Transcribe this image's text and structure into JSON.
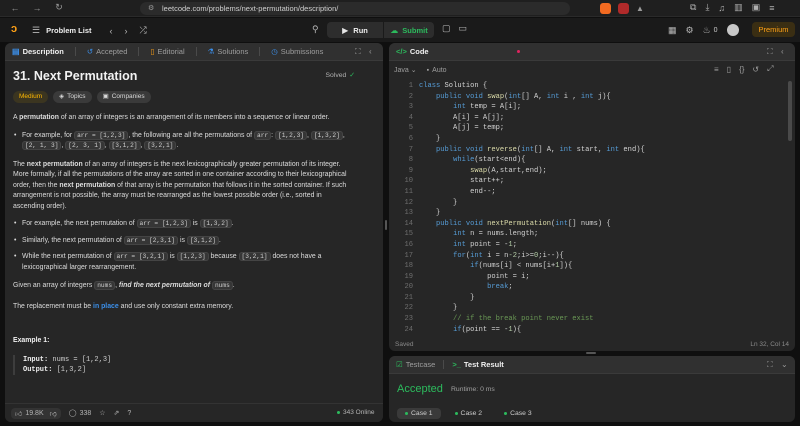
{
  "browser": {
    "url": "leetcode.com/problems/next-permutation/description/",
    "notification_count": "3"
  },
  "header": {
    "problem_list_label": "Problem List",
    "run_label": "Run",
    "submit_label": "Submit",
    "streak_count": "0",
    "premium_label": "Premium"
  },
  "left_tabs": [
    {
      "label": "Description",
      "icon": "description-icon"
    },
    {
      "label": "Accepted",
      "icon": "history-icon"
    },
    {
      "label": "Editorial",
      "icon": "book-icon"
    },
    {
      "label": "Solutions",
      "icon": "flask-icon"
    },
    {
      "label": "Submissions",
      "icon": "clock-icon"
    }
  ],
  "problem": {
    "title": "31. Next Permutation",
    "solved_label": "Solved",
    "difficulty": "Medium",
    "topics_label": "Topics",
    "companies_label": "Companies",
    "intro_bold": "permutation",
    "intro_pre": "A ",
    "intro_post": " of an array of integers is an arrangement of its members into a sequence or linear order.",
    "bullet1_pre": "For example, for ",
    "bullet1_code": "arr = [1,2,3]",
    "bullet1_post": ", the following are all the permutations of ",
    "bullet1_code2": "arr",
    "bullet1_codes": [
      "[1,2,3]",
      "[1,3,2]",
      "[2, 1, 3]",
      "[2, 3, 1]",
      "[3,1,2]",
      "[3,2,1]"
    ],
    "para2_pre": "The ",
    "para2_bold": "next permutation",
    "para2_mid": " of an array of integers is the next lexicographically greater permutation of its integer. More formally, if all the permutations of the array are sorted in one container according to their lexicographical order, then the ",
    "para2_bold2": "next permutation",
    "para2_post": " of that array is the permutation that follows it in the sorted container. If such arrangement is not possible, the array must be rearranged as the lowest possible order (i.e., sorted in ascending order).",
    "b2_pre": "For example, the next permutation of ",
    "b2_code": "arr = [1,2,3]",
    "b2_mid": " is ",
    "b2_code2": "[1,3,2]",
    "b3_pre": "Similarly, the next permutation of ",
    "b3_code": "arr = [2,3,1]",
    "b3_mid": " is ",
    "b3_code2": "[3,1,2]",
    "b4_pre": "While the next permutation of ",
    "b4_code": "arr = [3,2,1]",
    "b4_mid": " is ",
    "b4_code2": "[1,2,3]",
    "b4_mid2": " because ",
    "b4_code3": "[3,2,1]",
    "b4_post": " does not have a lexicographical larger rearrangement.",
    "given_pre": "Given an array of integers ",
    "given_code": "nums",
    "given_mid": ", ",
    "given_italic": "find the next permutation of",
    "given_code2": "nums",
    "given_post": ".",
    "replace_pre": "The replacement must be ",
    "replace_link": "in place",
    "replace_post": " and use only constant extra memory.",
    "example_title": "Example 1:",
    "example_input_label": "Input:",
    "example_input": "nums = [1,2,3]",
    "example_output_label": "Output:",
    "example_output": "[1,3,2]"
  },
  "desc_footer": {
    "likes": "19.8K",
    "comments": "338",
    "online": "343 Online"
  },
  "code_panel": {
    "title": "Code",
    "language": "Java",
    "auto_label": "Auto",
    "status_left": "Saved",
    "status_right": "Ln 32, Col 14",
    "line_numbers": [
      "1",
      "2",
      "3",
      "4",
      "5",
      "6",
      "7",
      "8",
      "9",
      "10",
      "11",
      "12",
      "13",
      "14",
      "15",
      "16",
      "17",
      "18",
      "19",
      "20",
      "21",
      "22",
      "23",
      "24"
    ],
    "lines": [
      "class Solution {",
      "    public void swap(int[] A, int i , int j){",
      "        int temp = A[i];",
      "        A[i] = A[j];",
      "        A[j] = temp;",
      "    }",
      "    public void reverse(int[] A, int start, int end){",
      "        while(start<end){",
      "            swap(A,start,end);",
      "            start++;",
      "            end--;",
      "        }",
      "    }",
      "    public void nextPermutation(int[] nums) {",
      "        int n = nums.length;",
      "        int point = -1;",
      "        for(int i = n-2;i>=0;i--){",
      "            if(nums[i] < nums[i+1]){",
      "                point = i;",
      "                break;",
      "            }",
      "        }",
      "        // if the break point never exist",
      "        if(point == -1){"
    ]
  },
  "test_panel": {
    "tab_testcase": "Testcase",
    "tab_result": "Test Result",
    "verdict": "Accepted",
    "runtime": "Runtime: 0 ms",
    "cases": [
      "Case 1",
      "Case 2",
      "Case 3"
    ]
  },
  "colors": {
    "accent_orange": "#ffa116",
    "success_green": "#2cbb5d",
    "link_blue": "#3b8ee8"
  }
}
